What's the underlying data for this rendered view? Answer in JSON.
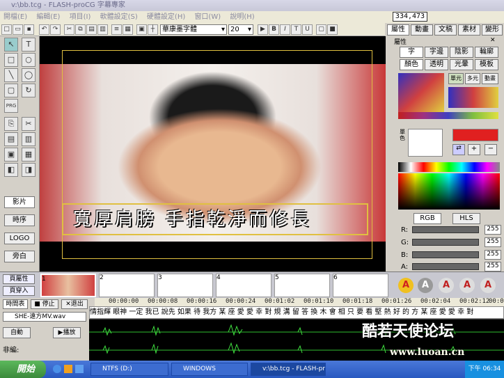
{
  "window": {
    "title": "v:\\bb.tcg - FLASH-proCG 字幕專家"
  },
  "menu": [
    "開檔(E)",
    "編輯(E)",
    "項目(I)",
    "軟體設定(S)",
    "硬體設定(H)",
    "窗口(W)",
    "說明(H)"
  ],
  "coord_readout": "334,473",
  "toolbar": {
    "font_name": "華康墨字體",
    "font_size": "20",
    "bold": "B",
    "italic": "I"
  },
  "left_tools": {
    "buttons": [
      "影片",
      "時序",
      "LOGO",
      "旁白"
    ]
  },
  "stage": {
    "subtitle": "寬厚肩膀 手指乾淨而修長"
  },
  "right_panel": {
    "tabs": [
      "屬性",
      "動畫",
      "文稿",
      "素材",
      "變形"
    ],
    "section_title": "屬性",
    "subtabs": [
      "字",
      "字邊",
      "陰影",
      "輪廓"
    ],
    "subtabs2": [
      "顏色",
      "透明",
      "光暈",
      "模板"
    ],
    "mode_buttons": [
      "單元",
      "多元",
      "動畫"
    ],
    "mode_vertical": "單色",
    "color_model": [
      "RGB",
      "HLS"
    ],
    "channels": [
      {
        "label": "R:",
        "value": "255"
      },
      {
        "label": "G:",
        "value": "255"
      },
      {
        "label": "B:",
        "value": "255"
      },
      {
        "label": "A:",
        "value": "255"
      }
    ],
    "letter_buttons": [
      "A",
      "A",
      "A",
      "A",
      "A"
    ]
  },
  "filmstrip": {
    "buttons": [
      "頁屬性",
      "頁穿入"
    ],
    "frames": [
      "1",
      "2",
      "3",
      "4",
      "5",
      "6"
    ]
  },
  "timeline": {
    "buttons": [
      "時間表",
      "停止",
      "退出"
    ],
    "audio_file": "SHE-遠方MV.wav",
    "auto_label": "自動",
    "play_label": "播放",
    "non_edit": "非編:",
    "ruler": [
      "00:00:00",
      "00:00:08",
      "00:00:16",
      "00:00:24",
      "00:01:02",
      "00:01:10",
      "00:01:18",
      "00:01:26",
      "00:02:04",
      "00:02:12",
      "00:02:20"
    ],
    "lyrics": "情指輝 眼神 一定 我已 說先 如果 待 我方 某 座 愛 愛 幸 對 規 溝 留 答 換 木 會 相 只 要 看 堅 熱 好 的 方 某 座 愛 愛 幸 對"
  },
  "taskbar": {
    "start": "開始",
    "tasks": [
      "NTFS (D:)",
      "WINDOWS",
      "v:\\bb.tcg - FLASH-pr..."
    ],
    "clock": "下午 06:34"
  },
  "watermark": {
    "text1": "酷若天使论坛",
    "text2": "www.luoan.cn"
  },
  "colors": {
    "accent": "#2858c0",
    "stage_bg": "#000000",
    "frame": "#e0c040"
  }
}
